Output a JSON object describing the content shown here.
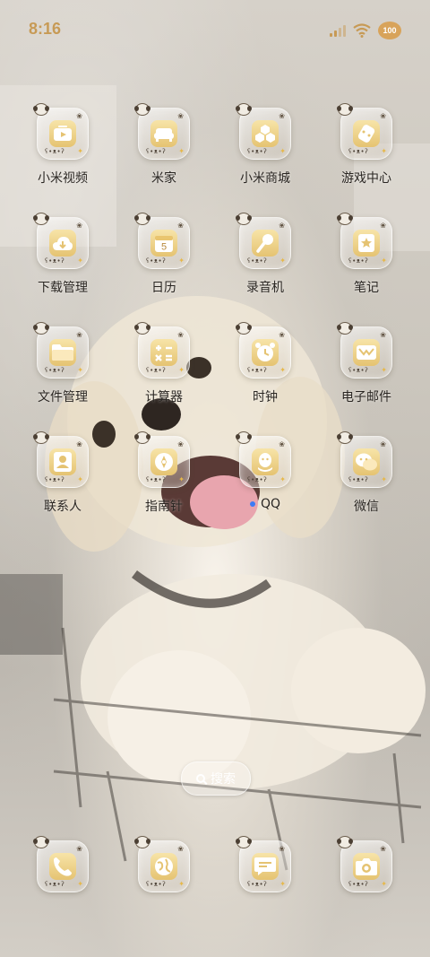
{
  "status_bar": {
    "time": "8:16",
    "battery_level": "100",
    "accent_color": "#c79a55"
  },
  "apps": [
    {
      "label": "小米视频",
      "icon": "video-play-icon",
      "notif": false
    },
    {
      "label": "米家",
      "icon": "sofa-icon",
      "notif": false
    },
    {
      "label": "小米商城",
      "icon": "hexagon-cluster-icon",
      "notif": false
    },
    {
      "label": "游戏中心",
      "icon": "gamepad-icon",
      "notif": false
    },
    {
      "label": "下载管理",
      "icon": "cloud-download-icon",
      "notif": false
    },
    {
      "label": "日历",
      "icon": "calendar-icon",
      "day": "5",
      "notif": false
    },
    {
      "label": "录音机",
      "icon": "microphone-icon",
      "notif": false
    },
    {
      "label": "笔记",
      "icon": "notebook-star-icon",
      "notif": false
    },
    {
      "label": "文件管理",
      "icon": "folder-icon",
      "notif": false
    },
    {
      "label": "计算器",
      "icon": "calculator-icon",
      "notif": false
    },
    {
      "label": "时钟",
      "icon": "alarm-clock-icon",
      "notif": false
    },
    {
      "label": "电子邮件",
      "icon": "envelope-icon",
      "notif": false
    },
    {
      "label": "联系人",
      "icon": "contact-card-icon",
      "notif": false
    },
    {
      "label": "指南针",
      "icon": "compass-icon",
      "notif": false
    },
    {
      "label": "QQ",
      "icon": "penguin-icon",
      "notif": true
    },
    {
      "label": "微信",
      "icon": "chat-bubbles-icon",
      "notif": false
    }
  ],
  "dock": [
    {
      "icon": "phone-icon"
    },
    {
      "icon": "browser-globe-icon"
    },
    {
      "icon": "message-icon"
    },
    {
      "icon": "camera-icon"
    }
  ],
  "search": {
    "label": "搜索"
  },
  "colors": {
    "icon_gold": "#e5c372",
    "label_text": "#2a2622",
    "notif_dot": "#3d7bf5"
  }
}
